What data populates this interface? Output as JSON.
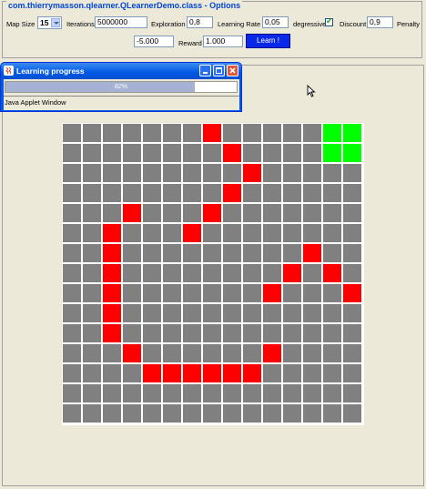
{
  "options": {
    "title": "com.thierrymasson.qlearner.QLearnerDemo.class - Options",
    "map_size_label": "Map Size",
    "map_size_value": "15",
    "iterations_label": "Iterations",
    "iterations_value": "5000000",
    "exploration_label": "Exploration",
    "exploration_value": "0,8",
    "learning_rate_label": "Learning Rate",
    "learning_rate_value": "0,05",
    "degressive_label": "degressive",
    "degressive_checked": true,
    "discount_label": "Discount",
    "discount_value": "0,9",
    "penalty_label": "Penalty",
    "penalty_value": "-5.000",
    "reward_label": "Reward",
    "reward_value": "1.000",
    "learn_button_label": "Learn !"
  },
  "progress_window": {
    "title": "Learning progress",
    "progress_text": "82%",
    "progress_value": 0.82,
    "applet_label": "Java Applet Window"
  },
  "grid": {
    "size": 15,
    "colors": {
      "empty": "#808080",
      "wall": "#ff0000",
      "goal": "#00ff00",
      "grid_line": "#ffffff"
    },
    "walls": [
      [
        0,
        7
      ],
      [
        1,
        8
      ],
      [
        2,
        9
      ],
      [
        3,
        8
      ],
      [
        4,
        3
      ],
      [
        4,
        7
      ],
      [
        5,
        2
      ],
      [
        5,
        6
      ],
      [
        6,
        2
      ],
      [
        6,
        12
      ],
      [
        7,
        2
      ],
      [
        7,
        11
      ],
      [
        7,
        13
      ],
      [
        8,
        2
      ],
      [
        8,
        10
      ],
      [
        8,
        14
      ],
      [
        9,
        2
      ],
      [
        10,
        2
      ],
      [
        11,
        3
      ],
      [
        11,
        10
      ],
      [
        12,
        4
      ],
      [
        12,
        5
      ],
      [
        12,
        6
      ],
      [
        12,
        7
      ],
      [
        12,
        8
      ],
      [
        12,
        9
      ]
    ],
    "goals": [
      [
        0,
        13
      ],
      [
        0,
        14
      ],
      [
        1,
        13
      ],
      [
        1,
        14
      ]
    ]
  }
}
